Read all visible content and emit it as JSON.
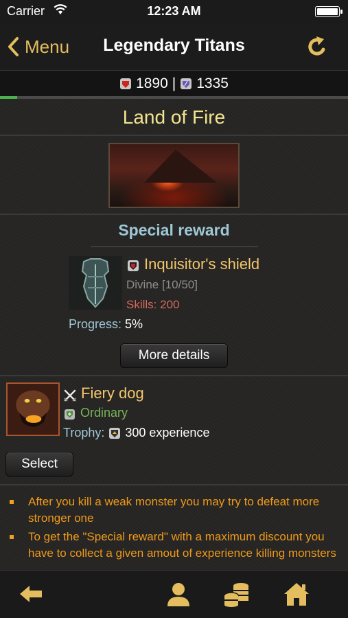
{
  "status_bar": {
    "carrier": "Carrier",
    "time": "12:23 AM"
  },
  "nav": {
    "back_label": "Menu",
    "title": "Legendary Titans"
  },
  "resources": {
    "red": "1890",
    "separator": "|",
    "purple": "1335"
  },
  "progress": {
    "fraction": 0.05
  },
  "location": {
    "title": "Land of Fire"
  },
  "special_reward": {
    "title": "Special reward",
    "item_name": "Inquisitor's shield",
    "quality": "Divine [10/50]",
    "skills": "Skills: 200",
    "progress_label": "Progress:",
    "progress_value": "5%",
    "details_button": "More details"
  },
  "monster": {
    "name": "Fiery dog",
    "rank": "Ordinary",
    "trophy_label": "Trophy:",
    "trophy_value": "300 experience",
    "select_button": "Select"
  },
  "tips": [
    "After you kill a weak monster you may try to defeat more stronger one",
    "To get the \"Special reward\" with a maximum discount you have to collect a given amout of experience killing monsters"
  ],
  "colors": {
    "accent": "#e3bd5e",
    "title": "#f3e48e",
    "tip": "#f09a18",
    "rank": "#78b458"
  }
}
